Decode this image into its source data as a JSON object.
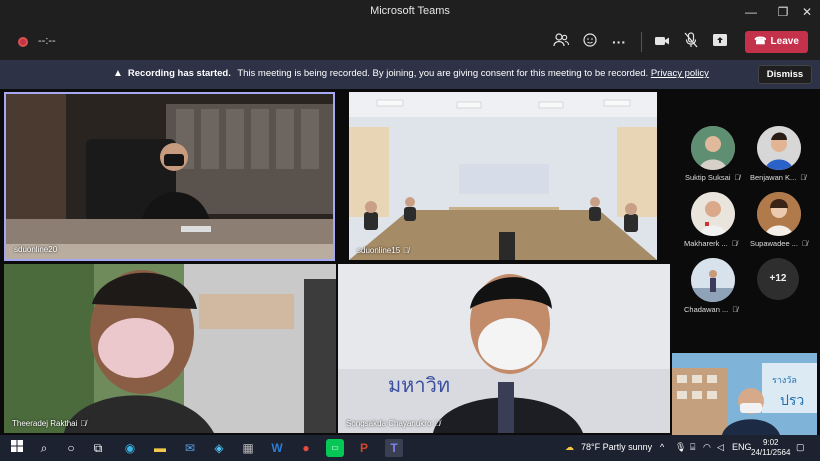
{
  "window": {
    "title": "Microsoft Teams"
  },
  "toolbar": {
    "timer": "--:--",
    "leave_label": "Leave"
  },
  "banner": {
    "heading": "Recording has started.",
    "message": "This meeting is being recorded. By joining, you are giving consent for this meeting to be recorded.",
    "link": "Privacy policy",
    "dismiss_label": "Dismiss"
  },
  "tiles": [
    {
      "name": "sduonline20"
    },
    {
      "name": "sduonline15"
    },
    {
      "name": "Theeradej Rakthai"
    },
    {
      "name": "Songsakda Chayanukro"
    }
  ],
  "participants": [
    {
      "name": "Suktip Suksai"
    },
    {
      "name": "Benjawan K..."
    },
    {
      "name": "Makharerk ..."
    },
    {
      "name": "Supawadee ..."
    },
    {
      "name": "Chadawan ..."
    }
  ],
  "overflow_count": "+12",
  "taskbar": {
    "weather_temp": "78°F",
    "weather_text": "Partly sunny",
    "language": "ENG",
    "time": "9:02",
    "date": "24/11/2564"
  },
  "colors": {
    "leave": "#c4314b",
    "banner": "#2d3246",
    "titlebar": "#1f1f1f",
    "taskbar": "#1c2230",
    "active_border": "#a6a9f2"
  }
}
